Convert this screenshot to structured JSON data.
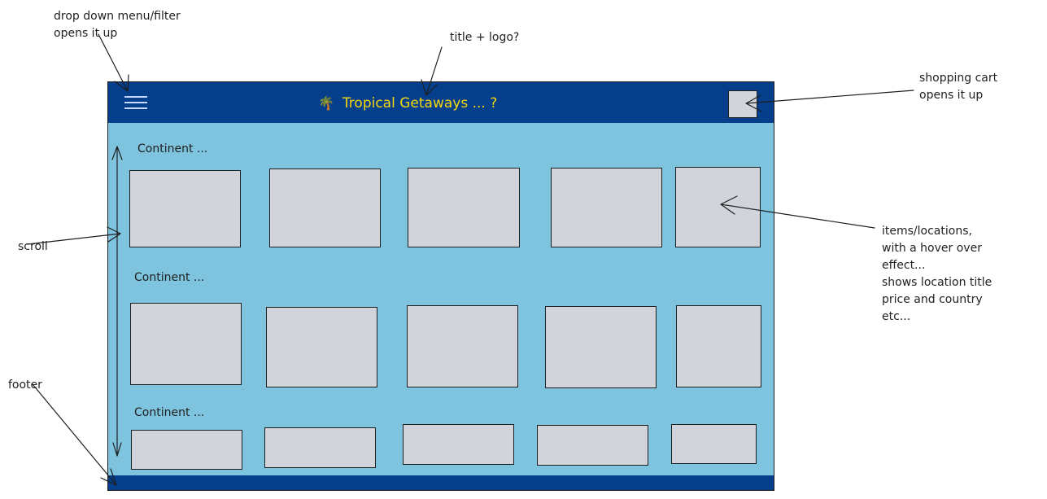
{
  "annotations": {
    "dropdown": "drop down menu/filter\nopens it up",
    "title": "title + logo?",
    "cart": "shopping cart\nopens it up",
    "items": "items/locations,\nwith a hover over\neffect...\nshows location title\nprice and country\netc...",
    "scroll": "scroll",
    "footer": "footer"
  },
  "app": {
    "title": "Tropical Getaways ... ?",
    "logo_icon": "palm-tree-icon",
    "menu_icon": "hamburger-menu-icon",
    "cart_icon": "shopping-cart-placeholder"
  },
  "sections": [
    {
      "label": "Continent ...",
      "item_count": 5
    },
    {
      "label": "Continent ...",
      "item_count": 5
    },
    {
      "label": "Continent ...",
      "item_count": 5
    }
  ],
  "colors": {
    "header_bg": "#053f8c",
    "footer_bg": "#053f8c",
    "page_bg": "#7fc4df",
    "title_text": "#f5d90a",
    "card_bg": "#d1d5db",
    "card_border": "#1e1e1e",
    "annotation_ink": "#222222"
  }
}
